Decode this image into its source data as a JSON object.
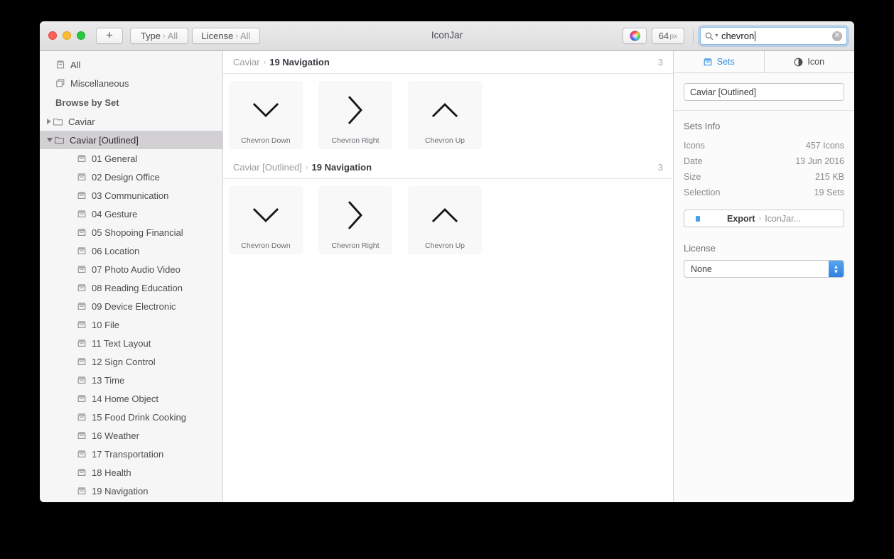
{
  "window": {
    "title": "IconJar"
  },
  "toolbar": {
    "add_label": "+",
    "type_filter": {
      "label": "Type",
      "separator": "›",
      "value": "All"
    },
    "license_filter": {
      "label": "License",
      "separator": "›",
      "value": "All"
    },
    "color_icon": "color-wheel-icon",
    "size": {
      "number": "64",
      "unit": "px"
    },
    "search": {
      "icon": "search-icon",
      "dropdown_icon": "chevron-down-icon",
      "value": "chevron",
      "placeholder": "Search",
      "clear_icon": "✕"
    }
  },
  "sidebar": {
    "top_items": [
      {
        "label": "All",
        "icon": "all-icons-stack-icon"
      },
      {
        "label": "Miscellaneous",
        "icon": "layered-squares-icon"
      }
    ],
    "section_title": "Browse by Set",
    "folders": [
      {
        "label": "Caviar",
        "icon": "folder-icon",
        "expanded": false,
        "selected": false
      },
      {
        "label": "Caviar [Outlined]",
        "icon": "folder-icon",
        "expanded": true,
        "selected": true
      }
    ],
    "sets": [
      {
        "label": "01 General"
      },
      {
        "label": "02 Design Office"
      },
      {
        "label": "03 Communication"
      },
      {
        "label": "04 Gesture"
      },
      {
        "label": "05 Shopoing Financial"
      },
      {
        "label": "06 Location"
      },
      {
        "label": "07 Photo Audio Video"
      },
      {
        "label": "08 Reading Education"
      },
      {
        "label": "09 Device Electronic"
      },
      {
        "label": "10 File"
      },
      {
        "label": "11 Text Layout"
      },
      {
        "label": "12 Sign Control"
      },
      {
        "label": "13 Time"
      },
      {
        "label": "14 Home Object"
      },
      {
        "label": "15 Food Drink Cooking"
      },
      {
        "label": "16 Weather"
      },
      {
        "label": "17 Transportation"
      },
      {
        "label": "18 Health"
      },
      {
        "label": "19 Navigation"
      }
    ]
  },
  "main": {
    "groups": [
      {
        "parent": "Caviar",
        "separator": "›",
        "name": "19 Navigation",
        "count": "3",
        "icons": [
          {
            "label": "Chevron Down",
            "glyph": "chevron-down-icon"
          },
          {
            "label": "Chevron Right",
            "glyph": "chevron-right-icon"
          },
          {
            "label": "Chevron Up",
            "glyph": "chevron-up-icon"
          }
        ]
      },
      {
        "parent": "Caviar [Outlined]",
        "separator": "›",
        "name": "19 Navigation",
        "count": "3",
        "icons": [
          {
            "label": "Chevron Down",
            "glyph": "chevron-down-icon"
          },
          {
            "label": "Chevron Right",
            "glyph": "chevron-right-icon"
          },
          {
            "label": "Chevron Up",
            "glyph": "chevron-up-icon"
          }
        ]
      }
    ]
  },
  "inspector": {
    "tabs": [
      {
        "label": "Sets",
        "icon": "set-box-icon",
        "active": true
      },
      {
        "label": "Icon",
        "icon": "half-circle-icon",
        "active": false
      }
    ],
    "name_value": "Caviar [Outlined]",
    "info_title": "Sets Info",
    "info_rows": [
      {
        "label": "Icons",
        "value": "457 Icons"
      },
      {
        "label": "Date",
        "value": "13 Jun 2016"
      },
      {
        "label": "Size",
        "value": "215 KB"
      },
      {
        "label": "Selection",
        "value": "19 Sets"
      }
    ],
    "export": {
      "label": "Export",
      "separator": "›",
      "target": "IconJar..."
    },
    "license": {
      "title": "License",
      "value": "None"
    }
  },
  "colors": {
    "accent": "#2f8fe0",
    "selection": "#d2d0d3",
    "tile_bg": "#f8f8f9"
  }
}
